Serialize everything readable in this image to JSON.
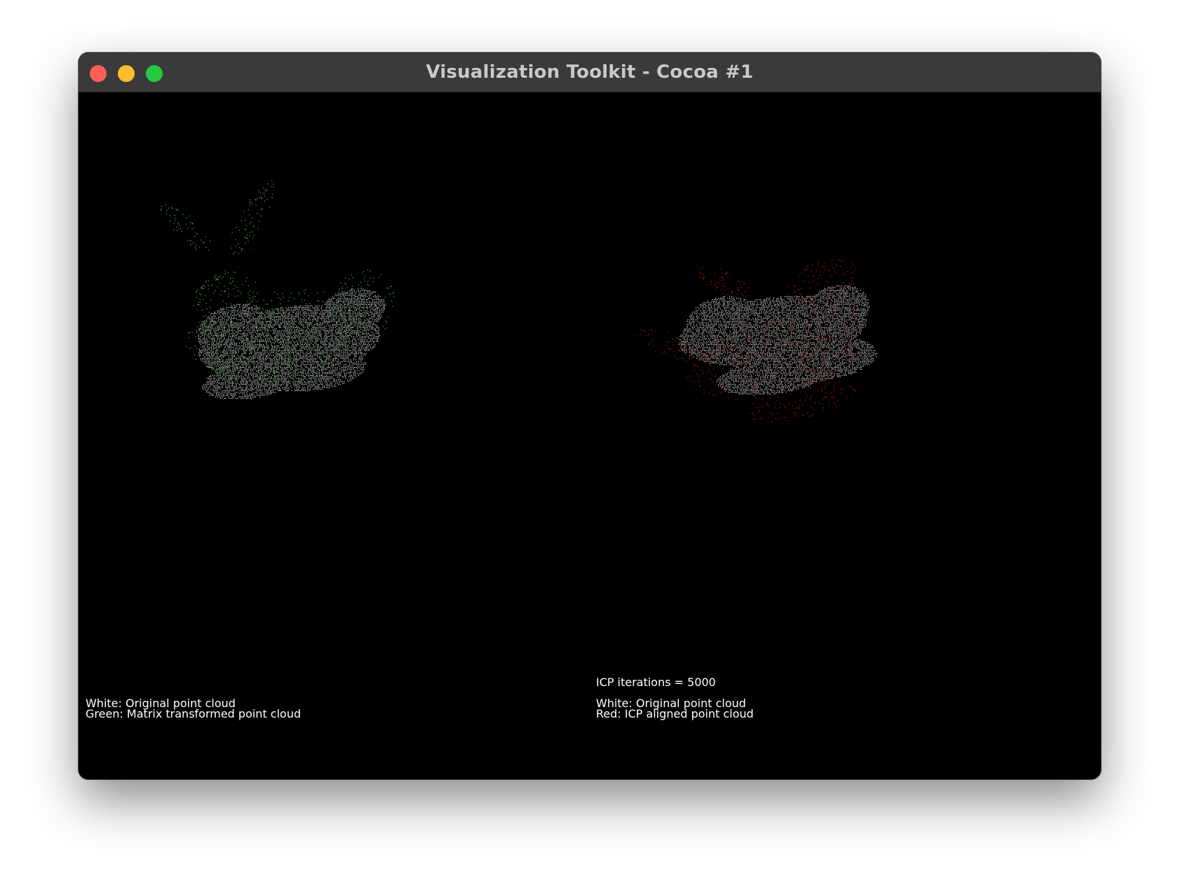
{
  "window": {
    "title": "Visualization Toolkit - Cocoa #1"
  },
  "left_view": {
    "legend_line1": "White: Original point cloud",
    "legend_line2": "Green: Matrix transformed point cloud",
    "original_color": "#ffffff",
    "transformed_color": "#3fc23f"
  },
  "right_view": {
    "iterations_label": "ICP iterations = 5000",
    "legend_line1": "White: Original point cloud",
    "legend_line2": "Red: ICP aligned point cloud",
    "original_color": "#ffffff",
    "aligned_color": "#c01818"
  },
  "background_color": "#000000"
}
